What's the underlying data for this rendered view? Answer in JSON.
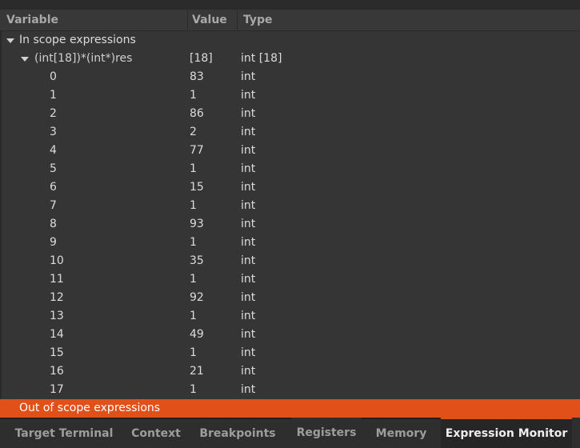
{
  "columns": {
    "variable": "Variable",
    "value": "Value",
    "type": "Type"
  },
  "in_scope_label": "In scope expressions",
  "expression": {
    "name": "(int[18])*(int*)res",
    "value": "[18]",
    "type": "int [18]"
  },
  "elements": [
    {
      "index": "0",
      "value": "83",
      "type": "int"
    },
    {
      "index": "1",
      "value": "1",
      "type": "int"
    },
    {
      "index": "2",
      "value": "86",
      "type": "int"
    },
    {
      "index": "3",
      "value": "2",
      "type": "int"
    },
    {
      "index": "4",
      "value": "77",
      "type": "int"
    },
    {
      "index": "5",
      "value": "1",
      "type": "int"
    },
    {
      "index": "6",
      "value": "15",
      "type": "int"
    },
    {
      "index": "7",
      "value": "1",
      "type": "int"
    },
    {
      "index": "8",
      "value": "93",
      "type": "int"
    },
    {
      "index": "9",
      "value": "1",
      "type": "int"
    },
    {
      "index": "10",
      "value": "35",
      "type": "int"
    },
    {
      "index": "11",
      "value": "1",
      "type": "int"
    },
    {
      "index": "12",
      "value": "92",
      "type": "int"
    },
    {
      "index": "13",
      "value": "1",
      "type": "int"
    },
    {
      "index": "14",
      "value": "49",
      "type": "int"
    },
    {
      "index": "15",
      "value": "1",
      "type": "int"
    },
    {
      "index": "16",
      "value": "21",
      "type": "int"
    },
    {
      "index": "17",
      "value": "1",
      "type": "int"
    }
  ],
  "out_of_scope_label": "Out of scope expressions",
  "tabs": [
    {
      "label": "Target Terminal",
      "active": false
    },
    {
      "label": "Context",
      "active": false
    },
    {
      "label": "Breakpoints",
      "active": false
    },
    {
      "label": "Registers",
      "active": false
    },
    {
      "label": "Memory",
      "active": false
    },
    {
      "label": "Expression Monitor",
      "active": true
    }
  ],
  "colors": {
    "accent": "#e2501a",
    "background": "#353535",
    "text": "#d6d6d6"
  }
}
